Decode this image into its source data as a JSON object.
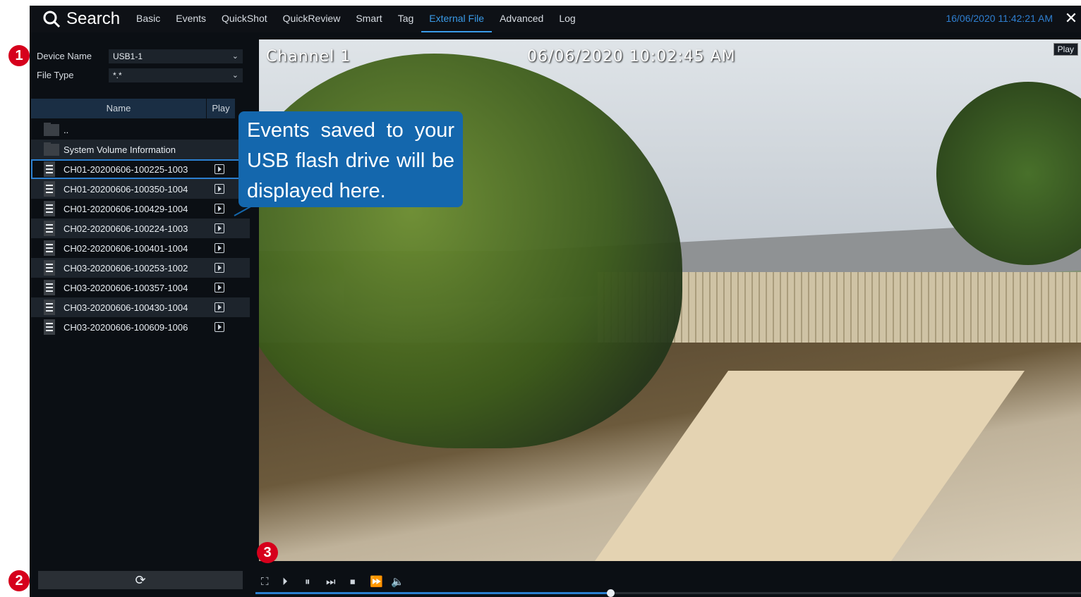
{
  "topbar": {
    "title": "Search",
    "tabs": [
      {
        "label": "Basic"
      },
      {
        "label": "Events"
      },
      {
        "label": "QuickShot"
      },
      {
        "label": "QuickReview"
      },
      {
        "label": "Smart"
      },
      {
        "label": "Tag"
      },
      {
        "label": "External File",
        "active": true
      },
      {
        "label": "Advanced"
      },
      {
        "label": "Log"
      }
    ],
    "datetime": "16/06/2020 11:42:21 AM",
    "close_icon": "close-icon"
  },
  "filters": {
    "device_name_label": "Device Name",
    "device_name_value": "USB1-1",
    "file_type_label": "File Type",
    "file_type_value": "*.*"
  },
  "table": {
    "col_name": "Name",
    "col_play": "Play",
    "rows": [
      {
        "name": "..",
        "type": "folder"
      },
      {
        "name": "System Volume Information",
        "type": "folder"
      },
      {
        "name": "CH01-20200606-100225-1003",
        "type": "file",
        "selected": true
      },
      {
        "name": "CH01-20200606-100350-1004",
        "type": "file"
      },
      {
        "name": "CH01-20200606-100429-1004",
        "type": "file"
      },
      {
        "name": "CH02-20200606-100224-1003",
        "type": "file"
      },
      {
        "name": "CH02-20200606-100401-1004",
        "type": "file"
      },
      {
        "name": "CH03-20200606-100253-1002",
        "type": "file"
      },
      {
        "name": "CH03-20200606-100357-1004",
        "type": "file"
      },
      {
        "name": "CH03-20200606-100430-1004",
        "type": "file"
      },
      {
        "name": "CH03-20200606-100609-1006",
        "type": "file"
      }
    ]
  },
  "video": {
    "channel": "Channel 1",
    "timestamp": "06/06/2020 10:02:45 AM",
    "play_tag": "Play"
  },
  "callout": {
    "text": "Events saved to your USB flash drive will be displayed here."
  },
  "markers": [
    "1",
    "2",
    "3"
  ],
  "playback": {
    "progress": 0.43
  },
  "colors": {
    "accent": "#2b7fd0",
    "callout": "#1467ad",
    "marker": "#d6001c"
  }
}
